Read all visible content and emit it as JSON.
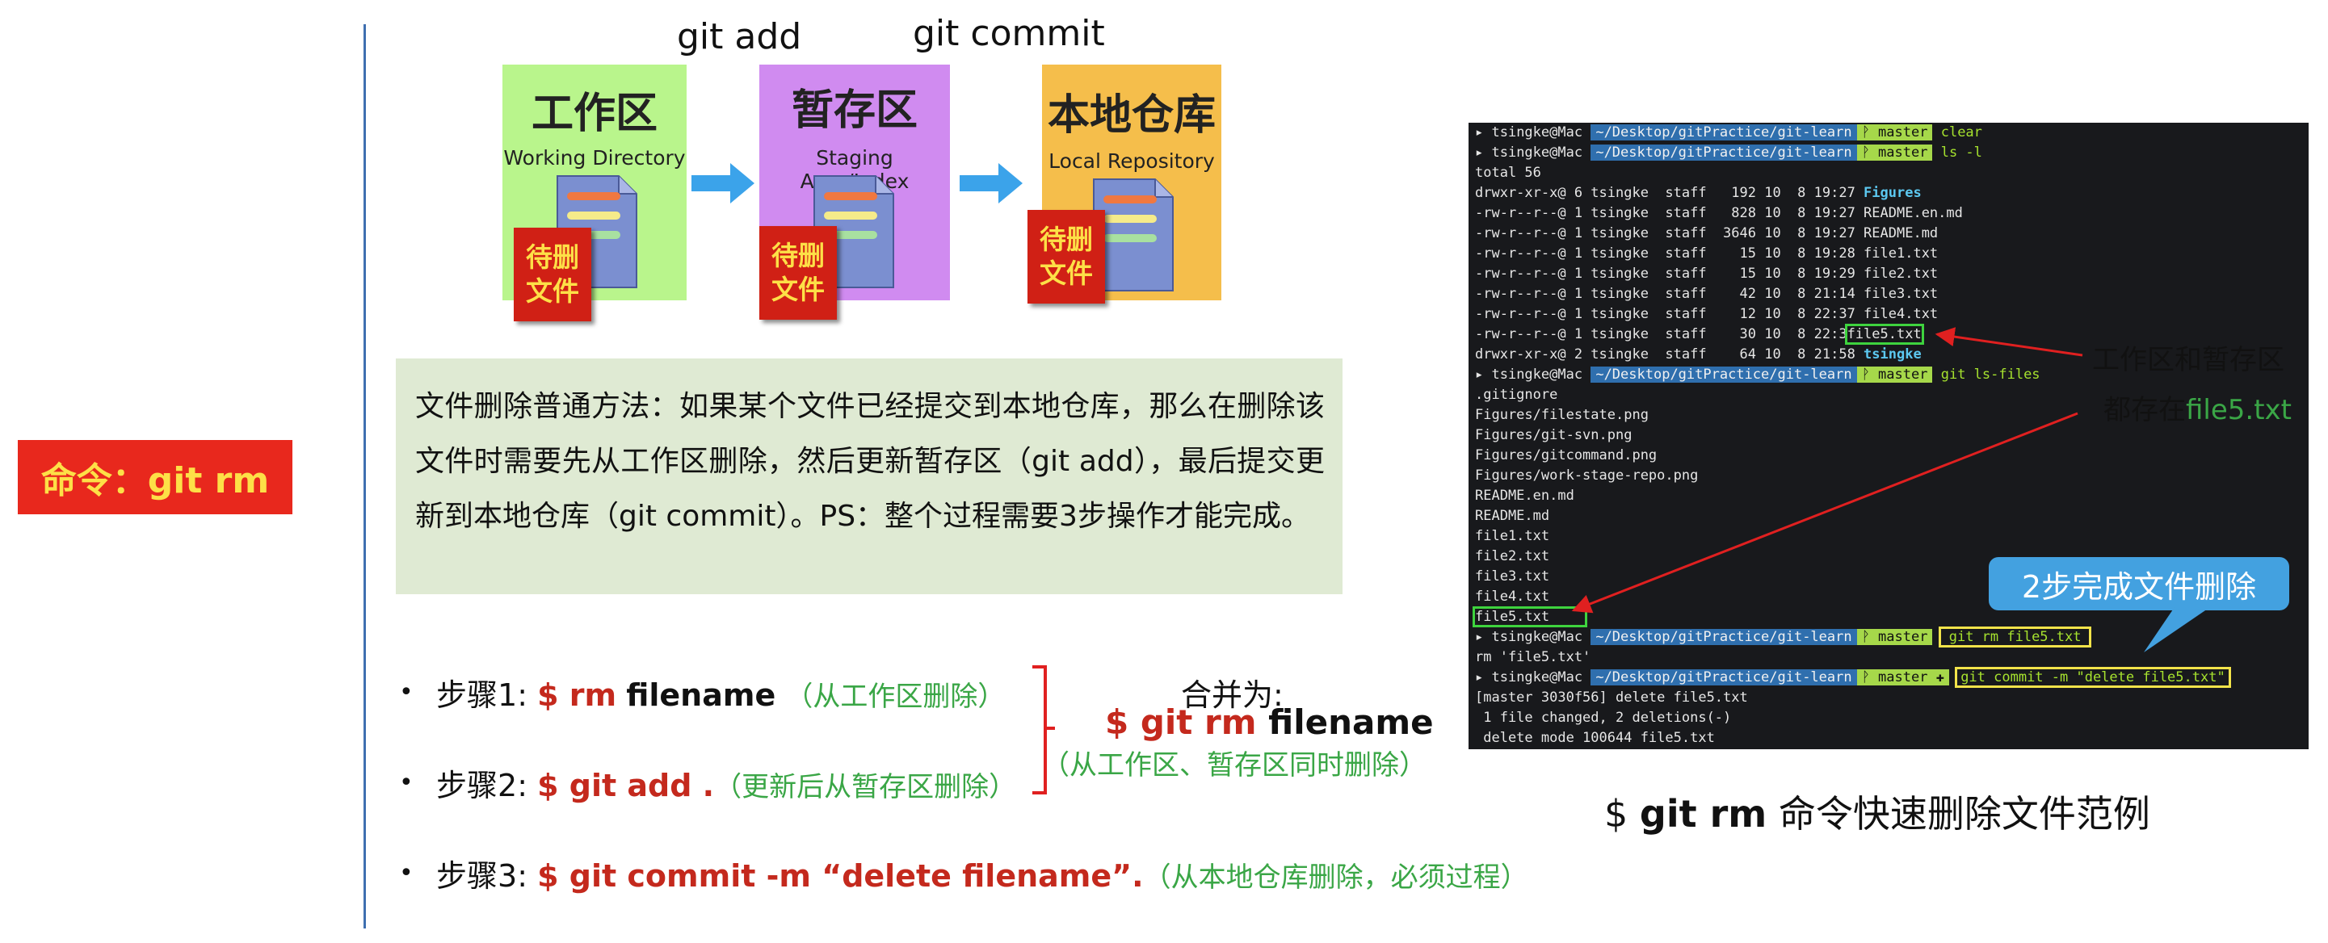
{
  "left_label": "命令：git rm",
  "top": {
    "step1_label": "git add",
    "step2_label": "git commit",
    "stages": [
      {
        "zh": "工作区",
        "en": "Working Directory",
        "color": "#b9f58c"
      },
      {
        "zh": "暂存区",
        "en": "Staging Area/Index",
        "color": "#d08bf0"
      },
      {
        "zh": "本地仓库",
        "en": "Local Repository",
        "color": "#f5be4b"
      }
    ],
    "badge_line1": "待删",
    "badge_line2": "文件"
  },
  "description": "文件删除普通方法：如果某个文件已经提交到本地仓库，那么在删除该文件时需要先从工作区删除，然后更新暂存区（git add），最后提交更新到本地仓库（git commit）。PS：整个过程需要3步操作才能完成。",
  "steps": [
    {
      "name": "步骤1",
      "sep": ":",
      "cmd": "$ rm",
      "cmd_black": "filename",
      "note": "（从工作区删除）"
    },
    {
      "name": "步骤2",
      "sep": ":",
      "cmd": "$ git add .",
      "cmd_black": "",
      "note": "（更新后从暂存区删除）"
    },
    {
      "name": "步骤3",
      "sep": ":",
      "cmd": "$ git commit -m “delete filename”.",
      "cmd_black": "",
      "note": "（从本地仓库删除，必须过程）"
    }
  ],
  "merge": {
    "title": "合并为:",
    "cmd_red": "$ git rm",
    "cmd_black": "filename",
    "note": "（从工作区、暂存区同时删除）"
  },
  "terminal": {
    "user": "tsingke@Mac",
    "path": "~/Desktop/gitPractice/git-learn",
    "branch": "master",
    "branch_plus": "master ✚",
    "cmds": [
      "clear",
      "ls -l",
      "git ls-files",
      "git rm file5.txt",
      "git commit -m \"delete file5.txt\""
    ],
    "total": "total 56",
    "ls_rows": [
      {
        "meta": "drwxr-xr-x@ 6 tsingke  staff   192 10  8 19:27 ",
        "name": "Figures"
      },
      {
        "meta": "-rw-r--r--@ 1 tsingke  staff   828 10  8 19:27 ",
        "name": "README.en.md"
      },
      {
        "meta": "-rw-r--r--@ 1 tsingke  staff  3646 10  8 19:27 ",
        "name": "README.md"
      },
      {
        "meta": "-rw-r--r--@ 1 tsingke  staff    15 10  8 19:28 ",
        "name": "file1.txt"
      },
      {
        "meta": "-rw-r--r--@ 1 tsingke  staff    15 10  8 19:29 ",
        "name": "file2.txt"
      },
      {
        "meta": "-rw-r--r--@ 1 tsingke  staff    42 10  8 21:14 ",
        "name": "file3.txt"
      },
      {
        "meta": "-rw-r--r--@ 1 tsingke  staff    12 10  8 22:37 ",
        "name": "file4.txt"
      },
      {
        "meta": "-rw-r--r--@ 1 tsingke  staff    30 10  8 22:3",
        "name": "file5.txt"
      },
      {
        "meta": "drwxr-xr-x@ 2 tsingke  staff    64 10  8 21:58 ",
        "name": "tsingke"
      }
    ],
    "files": [
      ".gitignore",
      "Figures/filestate.png",
      "Figures/git-svn.png",
      "Figures/gitcommand.png",
      "Figures/work-stage-repo.png",
      "README.en.md",
      "README.md",
      "file1.txt",
      "file2.txt",
      "file3.txt",
      "file4.txt",
      "file5.txt"
    ],
    "rm_out": "rm 'file5.txt'",
    "commit_out": [
      "[master 3030f56] delete file5.txt",
      " 1 file changed, 2 deletions(-)",
      " delete mode 100644 file5.txt"
    ]
  },
  "annot1": "工作区和暂存区",
  "annot2_pre": "都存在",
  "annot2_file": "file5.txt",
  "bubble": "2步完成文件删除",
  "caption_pre": "$ ",
  "caption_bold": "git rm",
  "caption_post": " 命令快速删除文件范例",
  "colors": {
    "red": "#e8281d",
    "green_note": "#3aa646",
    "path_blue": "#2f6fae",
    "branch_green": "#a6d84a"
  }
}
